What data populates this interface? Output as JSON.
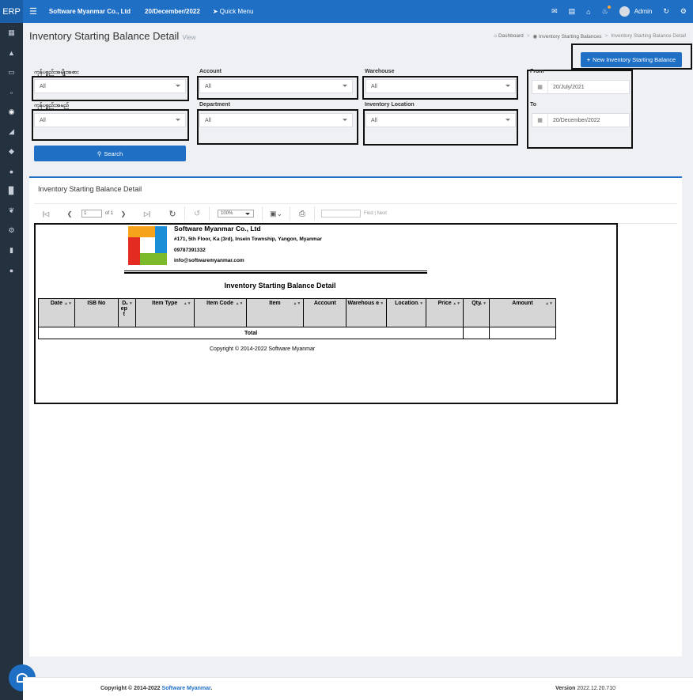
{
  "topbar": {
    "brand": "ERP",
    "company": "Software Myanmar Co., Ltd",
    "date": "20/December/2022",
    "quick_menu": "Quick Menu",
    "user": "Admin"
  },
  "header": {
    "title": "Inventory Starting Balance Detail",
    "subtitle": "View",
    "breadcrumb": [
      "Dashboard",
      "Inventory Starting Balances",
      "Inventory Starting Balance Detail"
    ],
    "new_button": "New Inventory Starting Balance"
  },
  "filters": {
    "item_type_label": "ကုန်ပစ္စည်းအမျိုးအစား",
    "item_type_value": "All",
    "item_label": "ကုန်ပစ္စည်းအမည်",
    "item_value": "All",
    "account_label": "Account",
    "account_value": "All",
    "department_label": "Department",
    "department_value": "All",
    "warehouse_label": "Warehouse",
    "warehouse_value": "All",
    "location_label": "Inventory Location",
    "location_value": "All",
    "from_label": "From",
    "from_value": "20/July/2021",
    "to_label": "To",
    "to_value": "20/December/2022",
    "search_button": "Search"
  },
  "panel": {
    "title": "Inventory Starting Balance Detail",
    "toolbar": {
      "page_value": "1",
      "page_of": "of 1",
      "zoom": "100%",
      "find": "Find",
      "next": "Next"
    }
  },
  "report": {
    "company": "Software Myanmar Co., Ltd",
    "address": "#171, 5th Floor, Ka (3rd), Insein Township, Yangon, Myanmar",
    "phone": "09787391332",
    "email": "info@softwaremyanmar.com",
    "title": "Inventory Starting Balance Detail",
    "columns": [
      "Date",
      "ISB No",
      "D ep t",
      "Item Type",
      "Item Code",
      "Item",
      "Account",
      "Warehous e",
      "Location",
      "Price",
      "Qty",
      "Amount"
    ],
    "total_label": "Total",
    "copyright": "Copyright © 2014-2022 Software Myanmar"
  },
  "footer": {
    "copyright_prefix": "Copyright © 2014-2022 ",
    "copyright_link": "Software Myanmar",
    "copyright_suffix": ".",
    "version_label": "Version",
    "version_value": "2022.12.20.710"
  },
  "colors": {
    "primary": "#1f6fc5",
    "sidebar": "#24313f",
    "background": "#eef0f4"
  }
}
